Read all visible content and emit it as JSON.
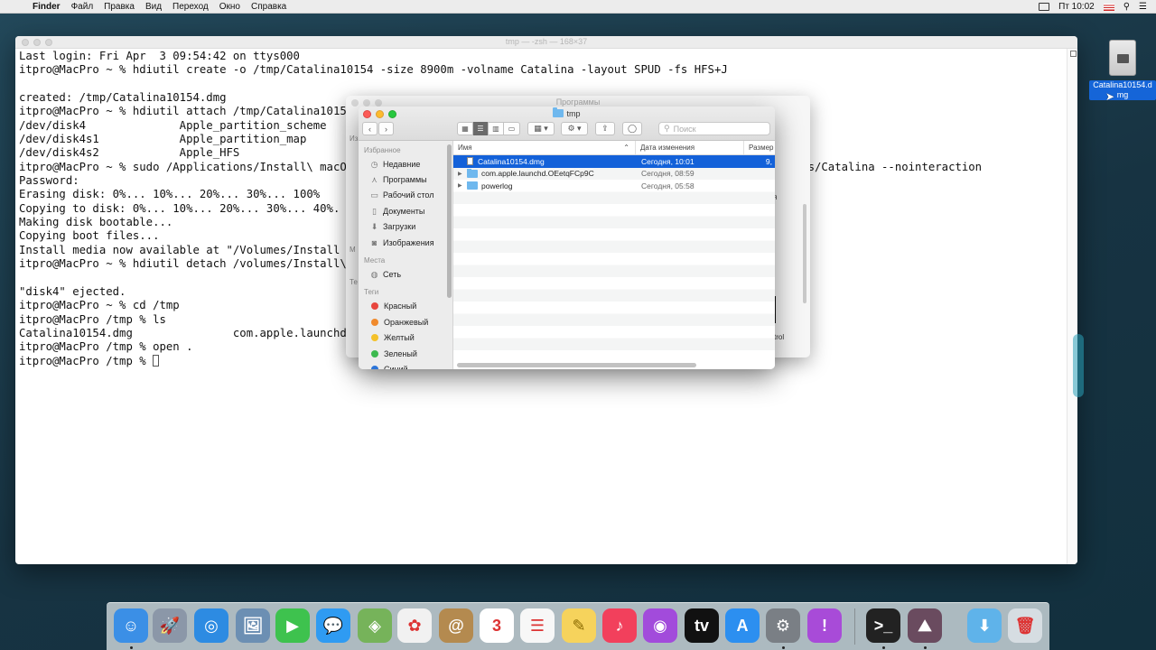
{
  "menubar": {
    "app": "Finder",
    "items": [
      "Файл",
      "Правка",
      "Вид",
      "Переход",
      "Окно",
      "Справка"
    ],
    "clock": "Пт 10:02"
  },
  "terminal": {
    "title": "tmp — -zsh — 168×37",
    "lines": [
      "Last login: Fri Apr  3 09:54:42 on ttys000",
      "itpro@MacPro ~ % hdiutil create -o /tmp/Catalina10154 -size 8900m -volname Catalina -layout SPUD -fs HFS+J",
      "",
      "created: /tmp/Catalina10154.dmg",
      "itpro@MacPro ~ % hdiutil attach /tmp/Catalina1015",
      "/dev/disk4              Apple_partition_scheme",
      "/dev/disk4s1            Apple_partition_map",
      "/dev/disk4s2            Apple_HFS",
      "itpro@MacPro ~ % sudo /Applications/Install\\ macOS                                                                    s/Catalina --nointeraction",
      "Password:",
      "Erasing disk: 0%... 10%... 20%... 30%... 100%",
      "Copying to disk: 0%... 10%... 20%... 30%... 40%.",
      "Making disk bootable...",
      "Copying boot files...",
      "Install media now available at \"/Volumes/Install m",
      "itpro@MacPro ~ % hdiutil detach /volumes/Install\\",
      "",
      "\"disk4\" ejected.",
      "itpro@MacPro ~ % cd /tmp",
      "itpro@MacPro /tmp % ls",
      "Catalina10154.dmg               com.apple.launchd.",
      "itpro@MacPro /tmp % open .",
      "itpro@MacPro /tmp % "
    ]
  },
  "finder_back": {
    "title": "Программы",
    "peek_left": [
      "Из",
      "М",
      "Те"
    ],
    "peek_right": [
      "я",
      "trol"
    ]
  },
  "finder": {
    "title": "tmp",
    "search_placeholder": "Поиск",
    "sidebar": {
      "favorites_header": "Избранное",
      "favorites": [
        {
          "label": "Недавние",
          "icon": "clock-icon"
        },
        {
          "label": "Программы",
          "icon": "apps-icon"
        },
        {
          "label": "Рабочий стол",
          "icon": "desktop-icon"
        },
        {
          "label": "Документы",
          "icon": "document-icon"
        },
        {
          "label": "Загрузки",
          "icon": "download-icon"
        },
        {
          "label": "Изображения",
          "icon": "camera-icon"
        }
      ],
      "places_header": "Места",
      "places": [
        {
          "label": "Сеть",
          "icon": "globe-icon"
        }
      ],
      "tags_header": "Теги",
      "tags": [
        {
          "label": "Красный",
          "color": "#e8463e"
        },
        {
          "label": "Оранжевый",
          "color": "#f08a2c"
        },
        {
          "label": "Желтый",
          "color": "#f4c12a"
        },
        {
          "label": "Зеленый",
          "color": "#3cb94f"
        },
        {
          "label": "Синий",
          "color": "#2c74d8"
        }
      ]
    },
    "columns": {
      "name": "Имя",
      "date": "Дата изменения",
      "size": "Размер"
    },
    "rows": [
      {
        "name": "Catalina10154.dmg",
        "date": "Сегодня, 10:01",
        "size": "9,",
        "kind": "file",
        "selected": true
      },
      {
        "name": "com.apple.launchd.OEetqFCp9C",
        "date": "Сегодня, 08:59",
        "size": "",
        "kind": "folder",
        "selected": false
      },
      {
        "name": "powerlog",
        "date": "Сегодня, 05:58",
        "size": "",
        "kind": "folder",
        "selected": false
      }
    ]
  },
  "desktop": {
    "file_label": "Catalina10154.dmg"
  },
  "dock": {
    "apps": [
      {
        "name": "finder",
        "color": "#3b8fe6",
        "glyph": "☺",
        "running": true
      },
      {
        "name": "launchpad",
        "color": "#8b97a8",
        "glyph": "🚀",
        "running": false
      },
      {
        "name": "safari",
        "color": "#2d8be2",
        "glyph": "◎",
        "running": false
      },
      {
        "name": "preview",
        "color": "#6c8fb3",
        "glyph": "🖼",
        "running": false
      },
      {
        "name": "facetime",
        "color": "#3ec24e",
        "glyph": "▶",
        "running": false
      },
      {
        "name": "messages",
        "color": "#2f9bf2",
        "glyph": "💬",
        "running": false
      },
      {
        "name": "maps",
        "color": "#76b35a",
        "glyph": "◈",
        "running": false
      },
      {
        "name": "photos",
        "color": "#f1f1f1",
        "glyph": "✿",
        "running": false
      },
      {
        "name": "contacts",
        "color": "#b48a4f",
        "glyph": "@",
        "running": false
      },
      {
        "name": "calendar",
        "color": "#ffffff",
        "glyph": "3",
        "running": false
      },
      {
        "name": "reminders",
        "color": "#f7f7f7",
        "glyph": "☰",
        "running": false
      },
      {
        "name": "notes",
        "color": "#f6d35c",
        "glyph": "✎",
        "running": false
      },
      {
        "name": "music",
        "color": "#f2405c",
        "glyph": "♪",
        "running": false
      },
      {
        "name": "podcasts",
        "color": "#a24bdb",
        "glyph": "◉",
        "running": false
      },
      {
        "name": "apple-tv",
        "color": "#111111",
        "glyph": "tv",
        "running": false
      },
      {
        "name": "app-store",
        "color": "#2c8ff0",
        "glyph": "A",
        "running": false
      },
      {
        "name": "system-preferences",
        "color": "#7a7f85",
        "glyph": "⚙",
        "running": true
      },
      {
        "name": "feedback-assistant",
        "color": "#a84bd8",
        "glyph": "!",
        "running": false
      },
      {
        "name": "terminal",
        "color": "#222222",
        "glyph": ">_",
        "running": true
      },
      {
        "name": "macos-installer",
        "color": "#6a4b5f",
        "glyph": "⛰",
        "running": true
      },
      {
        "name": "downloads-stack",
        "color": "#5fb3ea",
        "glyph": "⬇",
        "running": false
      },
      {
        "name": "trash",
        "color": "#d6dde2",
        "glyph": "🗑",
        "running": false
      }
    ]
  }
}
